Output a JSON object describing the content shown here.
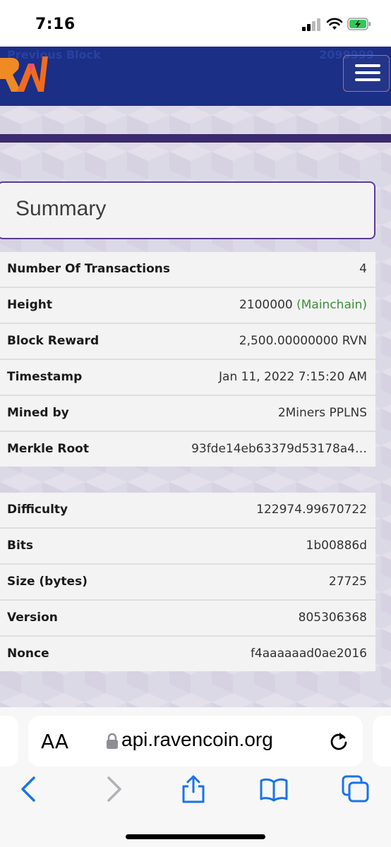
{
  "status_bar": {
    "time": "7:16"
  },
  "header": {
    "ghost_label": "Previous Block",
    "ghost_value": "2099999"
  },
  "summary": {
    "title": "Summary",
    "rows": [
      {
        "label": "Number Of Transactions",
        "value": "4"
      },
      {
        "label": "Height",
        "value": "2100000",
        "note": "(Mainchain)"
      },
      {
        "label": "Block Reward",
        "value": "2,500.00000000 RVN"
      },
      {
        "label": "Timestamp",
        "value": "Jan 11, 2022 7:15:20 AM"
      },
      {
        "label": "Mined by",
        "value": "2Miners PPLNS"
      },
      {
        "label": "Merkle Root",
        "value": "93fde14eb63379d53178a4…"
      }
    ]
  },
  "details": {
    "rows": [
      {
        "label": "Difficulty",
        "value": "122974.99670722"
      },
      {
        "label": "Bits",
        "value": "1b00886d"
      },
      {
        "label": "Size (bytes)",
        "value": "27725"
      },
      {
        "label": "Version",
        "value": "805306368"
      },
      {
        "label": "Nonce",
        "value": "f4aaaaaad0ae2016"
      }
    ]
  },
  "browser": {
    "text_size_label": "AA",
    "url": "api.ravencoin.org"
  },
  "colors": {
    "header_bg": "#1b2f86",
    "mainchain_green": "#3f8f3f",
    "link_purple": "#5b2fb6",
    "ios_blue": "#1a73e8"
  },
  "icons": [
    "signal-icon",
    "wifi-icon",
    "battery-charging-icon",
    "ravencoin-logo",
    "hamburger-menu-icon",
    "lock-icon",
    "reload-icon",
    "back-icon",
    "forward-icon",
    "share-icon",
    "bookmarks-icon",
    "tabs-icon"
  ]
}
